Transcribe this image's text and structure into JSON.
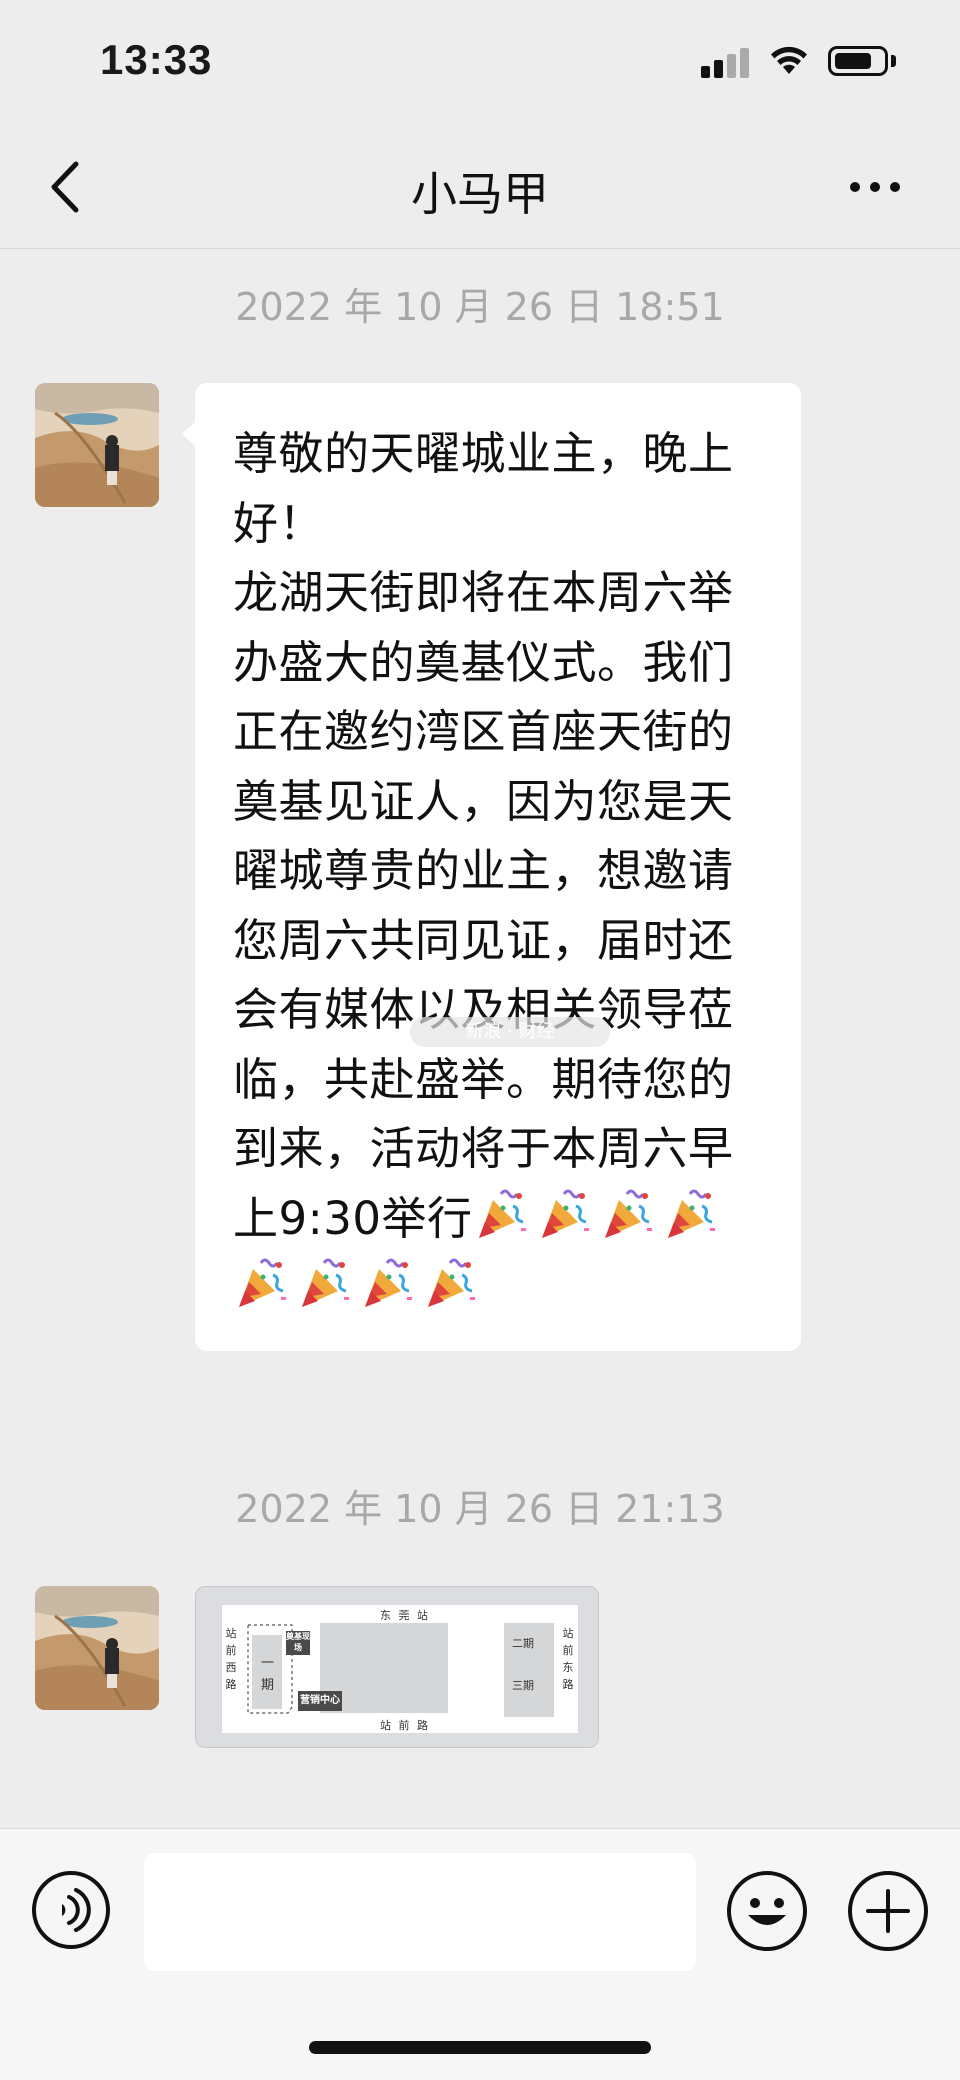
{
  "status_bar": {
    "time": "13:33",
    "signal_icon": "cellular-signal-icon",
    "wifi_icon": "wifi-icon",
    "battery_icon": "battery-icon"
  },
  "nav": {
    "title": "小马甲",
    "back_icon": "chevron-left-icon",
    "more_icon": "more-dots-icon"
  },
  "messages": [
    {
      "timestamp": "2022 年 10 月 26 日  18:51",
      "sender_avatar": "avatar-desert-photo",
      "type": "text",
      "text": "尊敬的天曜城业主，晚上好！\n龙湖天街即将在本周六举办盛大的奠基仪式。我们正在邀约湾区首座天街的奠基见证人，因为您是天曜城尊贵的业主，想邀请您周六共同见证，届时还会有媒体以及相关领导莅临，共赴盛举。期待您的到来，活动将于本周六早上9:30举行",
      "emoji": "party-popper",
      "emoji_count": 8
    },
    {
      "timestamp": "2022 年 10 月 26 日  21:13",
      "sender_avatar": "avatar-desert-photo",
      "type": "image",
      "image": {
        "top_road": "东 莞 站",
        "bottom_road": "站 前 路",
        "left_road": "站前西路",
        "right_road": "站前东路",
        "phase_one": "一期",
        "phase_two": "二期",
        "phase_three": "三期",
        "ceremony_site": "奠基现场",
        "sales_center": "营销中心"
      }
    }
  ],
  "watermark": "新浪 · 财经",
  "input_bar": {
    "placeholder": "",
    "voice_icon": "voice-input-icon",
    "emoji_icon": "emoji-smile-icon",
    "plus_icon": "plus-circle-icon"
  },
  "colors": {
    "background": "#ededed",
    "bubble": "#ffffff",
    "timestamp": "#a8a8a8",
    "text": "#111111"
  }
}
